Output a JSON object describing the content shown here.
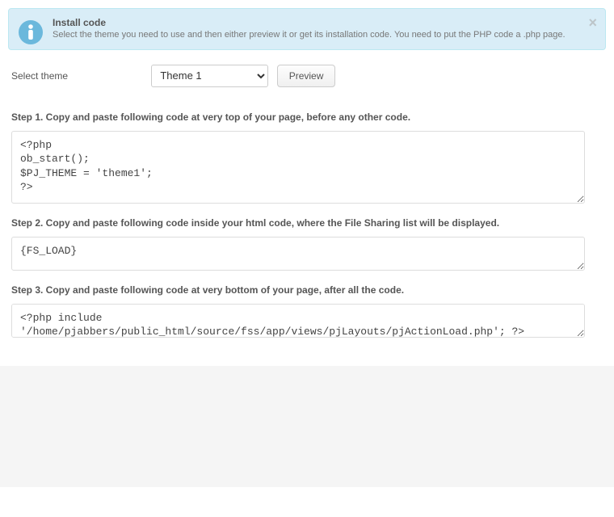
{
  "alert": {
    "title": "Install code",
    "body": "Select the theme you need to use and then either preview it or get its installation code. You need to put the PHP code a .php page."
  },
  "form": {
    "select_theme_label": "Select theme",
    "theme_selected": "Theme 1",
    "preview_label": "Preview"
  },
  "steps": {
    "step1_title": "Step 1. Copy and paste following code at very top of your page, before any other code.",
    "step1_code": "<?php\nob_start();\n$PJ_THEME = 'theme1';\n?>",
    "step2_title": "Step 2. Copy and paste following code inside your html code, where the File Sharing list will be displayed.",
    "step2_code": "{FS_LOAD}",
    "step3_title": "Step 3. Copy and paste following code at very bottom of your page, after all the code.",
    "step3_code": "<?php include '/home/pjabbers/public_html/source/fss/app/views/pjLayouts/pjActionLoad.php'; ?>"
  }
}
